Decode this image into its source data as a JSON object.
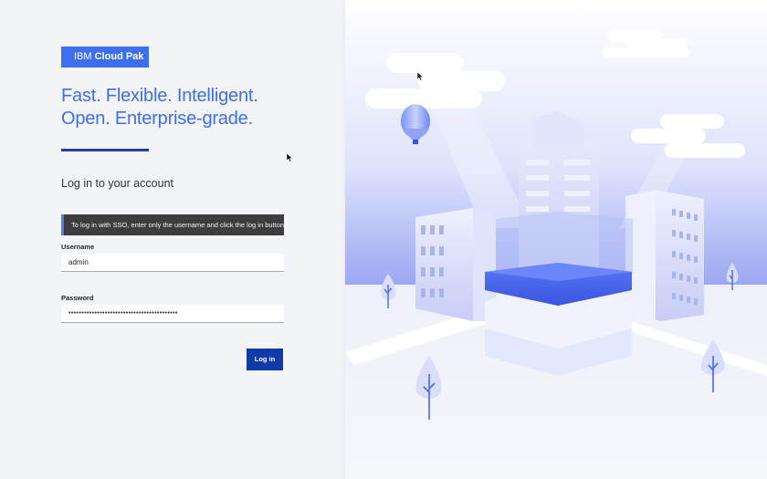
{
  "brand": {
    "prefix": "IBM",
    "name": "Cloud Pak"
  },
  "tagline": {
    "line1": "Fast. Flexible. Intelligent.",
    "line2": "Open. Enterprise-grade."
  },
  "login": {
    "heading": "Log in to your account",
    "sso_notice": "To log in with SSO, enter only the username and click the log in button",
    "username_label": "Username",
    "username_value": "admin",
    "password_label": "Password",
    "password_value": "••••••••••••••••••••••••••••••••••••••••••",
    "submit_label": "Log in"
  },
  "colors": {
    "brand_blue": "#3d6ef0",
    "button_blue": "#0f3aa8",
    "banner_dark": "#3d3d3d",
    "illustration_blue": "#4a68f0"
  },
  "illustration": {
    "semantic": "city-buildings-balloon-trees-illustration"
  }
}
